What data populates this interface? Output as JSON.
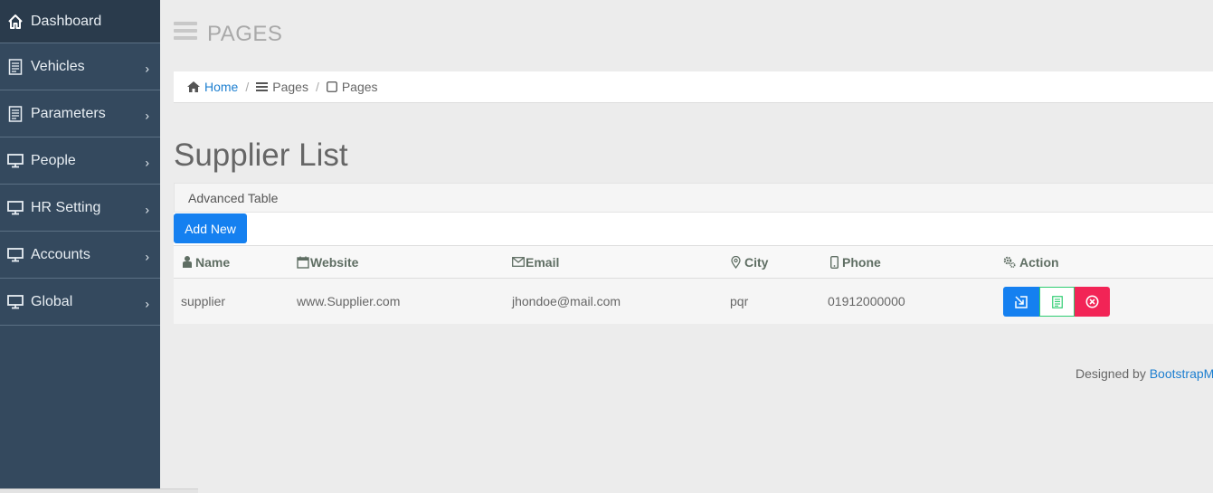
{
  "sidebar": {
    "items": [
      {
        "label": "Dashboard",
        "icon": "home-icon"
      },
      {
        "label": "Vehicles",
        "icon": "document-icon"
      },
      {
        "label": "Parameters",
        "icon": "document-icon"
      },
      {
        "label": "People",
        "icon": "monitor-icon"
      },
      {
        "label": "HR Setting",
        "icon": "monitor-icon"
      },
      {
        "label": "Accounts",
        "icon": "monitor-icon"
      },
      {
        "label": "Global",
        "icon": "monitor-icon"
      }
    ],
    "chevron": "›"
  },
  "header": {
    "title": "PAGES"
  },
  "breadcrumb": {
    "home": "Home",
    "sep": "/",
    "level1": "Pages",
    "level2": "Pages"
  },
  "main": {
    "title": "Supplier List",
    "panel_title": "Advanced Table",
    "add_button": "Add New"
  },
  "table": {
    "columns": [
      "Name",
      "Website",
      "Email",
      "City",
      "Phone",
      "Action"
    ],
    "rows": [
      {
        "name": "supplier",
        "website": "www.Supplier.com",
        "email": "jhondoe@mail.com",
        "city": "pqr",
        "phone": "01912000000"
      }
    ]
  },
  "footer": {
    "text": "Designed by ",
    "link": "BootstrapM"
  },
  "colors": {
    "sidebar": "#34495e",
    "primary": "#1580f0",
    "danger": "#f22456",
    "success": "#2ecc71"
  }
}
